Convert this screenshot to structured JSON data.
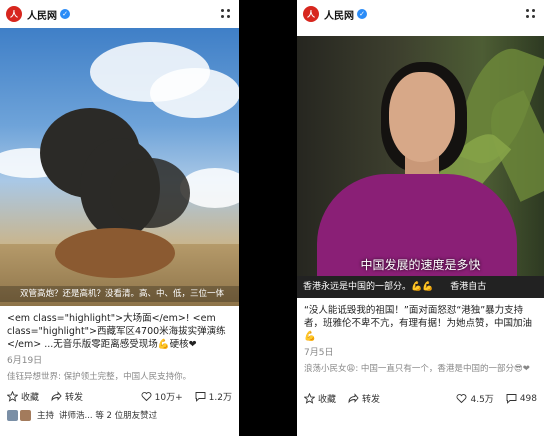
{
  "left_post": {
    "account": "人民网",
    "logo_text": "人",
    "video_caption": "双管高炮？还是高机？没看清。高、中、低，三位一体",
    "text": "<em class=\"highlight\">大场面</em>! <em class=\"highlight\">西藏军区4700米海拔实弹演练</em> ...无音乐版零距离感受现场💪硬核❤",
    "date": "6月19日",
    "comment_user": "佳钰异想世界:",
    "comment_text": " 保护领土完整，中国人民支持你。",
    "actions": {
      "save": "收藏",
      "share": "转发",
      "likes": "10万+",
      "comments": "1.2万"
    },
    "footer": {
      "host_label": "主持",
      "friends": "讲师浩... 等 2 位朋友赞过"
    }
  },
  "right_post": {
    "account": "人民网",
    "logo_text": "人",
    "subtitle": "中国发展的速度是多快",
    "ticker_left": "香港永远是中国的一部分。💪💪",
    "ticker_right": "香港自古",
    "text": "“没人能诋毁我的祖国！”面对面怒怼“港独”暴力支持者，班雅伦不卑不亢，有理有据！为她点赞，中国加油💪",
    "date": "7月5日",
    "comment_user": "浪荡小民女😩:",
    "comment_text": " 中国一直只有一个，香港是中国的一部分😎❤",
    "actions": {
      "save": "收藏",
      "share": "转发",
      "likes": "4.5万",
      "comments": "498"
    }
  },
  "colors": {
    "accent": "#d7261e",
    "verified": "#2b8cf7"
  }
}
